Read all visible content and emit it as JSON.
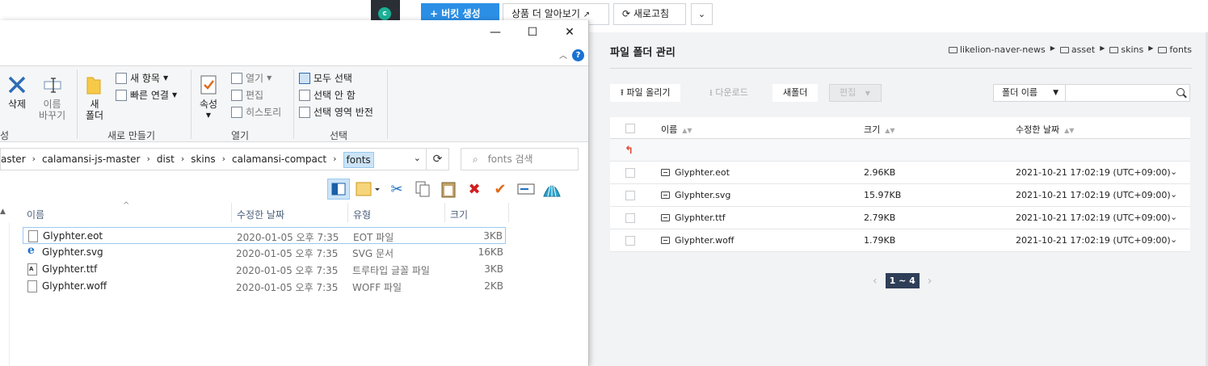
{
  "web": {
    "top_buttons": {
      "create_bucket": "+ 버킷 생성",
      "learn_more": "상품 더 알아보기",
      "refresh": "새로고침"
    },
    "panel_title": "파일 폴더 관리",
    "breadcrumb": [
      "likelion-naver-news",
      "asset",
      "skins",
      "fonts"
    ],
    "toolbar": {
      "upload": "파일 올리기",
      "download": "다운로드",
      "new_folder": "새폴더",
      "edit": "편집",
      "search_select": "폴더 이름"
    },
    "table": {
      "headers": {
        "name": "이름",
        "size": "크기",
        "modified": "수정한 날짜"
      },
      "rows": [
        {
          "name": "Glyphter.eot",
          "size": "2.96KB",
          "modified": "2021-10-21 17:02:19 (UTC+09:00)"
        },
        {
          "name": "Glyphter.svg",
          "size": "15.97KB",
          "modified": "2021-10-21 17:02:19 (UTC+09:00)"
        },
        {
          "name": "Glyphter.ttf",
          "size": "2.79KB",
          "modified": "2021-10-21 17:02:19 (UTC+09:00)"
        },
        {
          "name": "Glyphter.woff",
          "size": "1.79KB",
          "modified": "2021-10-21 17:02:19 (UTC+09:00)"
        }
      ]
    },
    "pager": {
      "current": "1 ~ 4"
    },
    "colors": {
      "primary": "#2b8fe6",
      "pager": "#2f3e57",
      "upfolder": "#e0442d"
    }
  },
  "explorer": {
    "ribbon": {
      "delete": "삭제",
      "rename_1": "이름",
      "rename_2": "바꾸기",
      "new_folder_1": "새",
      "new_folder_2": "폴더",
      "new_item": "새 항목",
      "easy_access": "빠른 연결",
      "properties": "속성",
      "open": "열기",
      "edit": "편집",
      "history": "히스토리",
      "select_all": "모두 선택",
      "select_none": "선택 안 함",
      "invert_selection": "선택 영역 반전",
      "group_left_fragment": "성",
      "group_new": "새로 만들기",
      "group_open": "열기",
      "group_select": "선택"
    },
    "address": [
      "aster",
      "calamansi-js-master",
      "dist",
      "skins",
      "calamansi-compact",
      "fonts"
    ],
    "search_placeholder": "fonts 검색",
    "columns": {
      "name": "이름",
      "modified": "수정한 날짜",
      "type": "유형",
      "size": "크기"
    },
    "files": [
      {
        "name": "Glyphter.eot",
        "modified": "2020-01-05 오후 7:35",
        "type": "EOT 파일",
        "size": "3KB",
        "icon": "file-icon"
      },
      {
        "name": "Glyphter.svg",
        "modified": "2020-01-05 오후 7:35",
        "type": "SVG 문서",
        "size": "16KB",
        "icon": "ie-icon"
      },
      {
        "name": "Glyphter.ttf",
        "modified": "2020-01-05 오후 7:35",
        "type": "트루타입 글꼴 파일",
        "size": "3KB",
        "icon": "font-file-icon"
      },
      {
        "name": "Glyphter.woff",
        "modified": "2020-01-05 오후 7:35",
        "type": "WOFF 파일",
        "size": "2KB",
        "icon": "file-icon"
      }
    ]
  }
}
